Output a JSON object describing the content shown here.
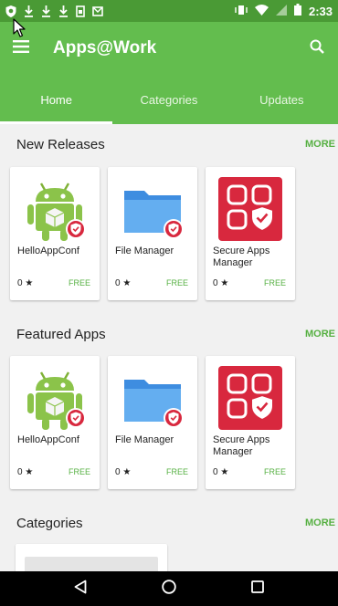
{
  "status_bar": {
    "time": "2:33",
    "icons": [
      "shield-icon",
      "download-icon",
      "download-icon",
      "download-icon",
      "sim-icon",
      "mail-icon",
      "vibrate-icon",
      "wifi-icon",
      "signal-icon",
      "battery-icon"
    ]
  },
  "app_bar": {
    "title": "Apps@Work"
  },
  "tabs": [
    {
      "label": "Home",
      "active": true
    },
    {
      "label": "Categories",
      "active": false
    },
    {
      "label": "Updates",
      "active": false
    }
  ],
  "sections": [
    {
      "title": "New Releases",
      "more": "MORE",
      "apps": [
        {
          "name": "HelloAppConf",
          "rating": "0 ★",
          "price": "FREE",
          "icon": "android-app-icon"
        },
        {
          "name": "File Manager",
          "rating": "0 ★",
          "price": "FREE",
          "icon": "folder-app-icon"
        },
        {
          "name": "Secure Apps Manager",
          "rating": "0 ★",
          "price": "FREE",
          "icon": "secure-apps-icon"
        }
      ]
    },
    {
      "title": "Featured Apps",
      "more": "MORE",
      "apps": [
        {
          "name": "HelloAppConf",
          "rating": "0 ★",
          "price": "FREE",
          "icon": "android-app-icon"
        },
        {
          "name": "File Manager",
          "rating": "0 ★",
          "price": "FREE",
          "icon": "folder-app-icon"
        },
        {
          "name": "Secure Apps Manager",
          "rating": "0 ★",
          "price": "FREE",
          "icon": "secure-apps-icon"
        }
      ]
    },
    {
      "title": "Categories",
      "more": "MORE"
    }
  ],
  "colors": {
    "status_bar": "#4a9a35",
    "app_bar": "#63bd4e",
    "accent": "#56b042",
    "badge": "#d8283e",
    "nav_bar": "#000000"
  },
  "nav_bar": [
    "back-icon",
    "home-icon",
    "recents-icon"
  ]
}
